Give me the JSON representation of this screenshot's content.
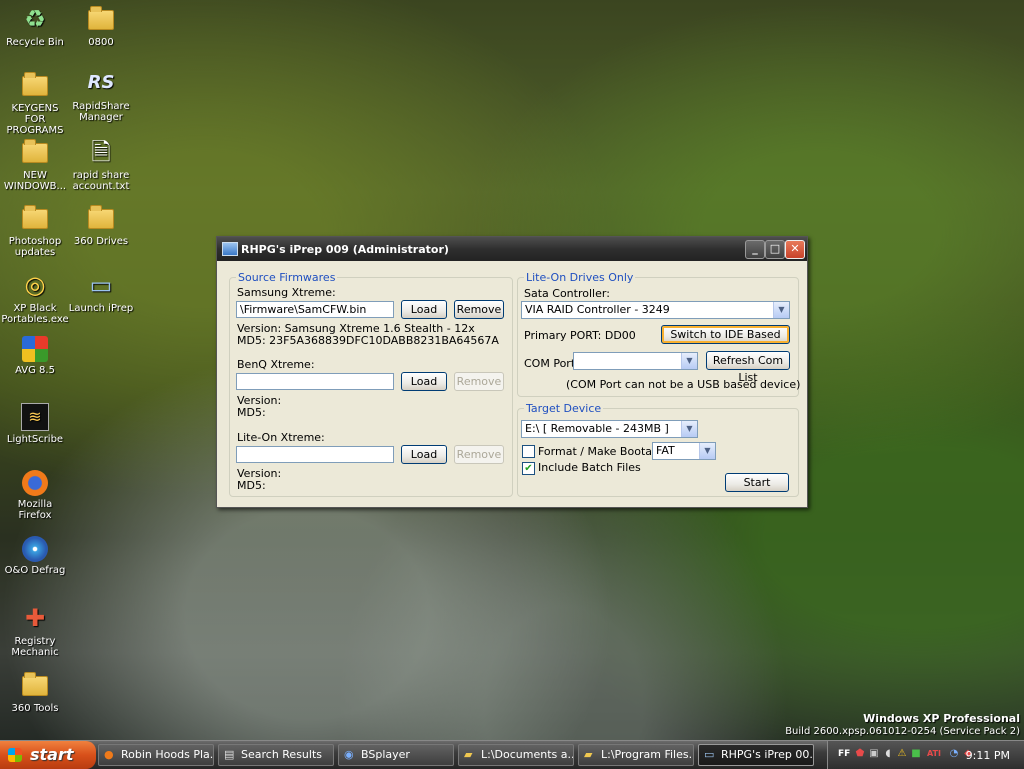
{
  "desktop": {
    "icons": [
      {
        "label": "Recycle Bin",
        "glyph": "recycle-bin-icon"
      },
      {
        "label": "0800",
        "glyph": "folder-icon"
      },
      {
        "label": "KEYGENS FOR PROGRAMS",
        "glyph": "folder-icon"
      },
      {
        "label": "RapidShare Manager",
        "glyph": "rapidshare-icon"
      },
      {
        "label": "NEW WINDOWB...",
        "glyph": "folder-icon"
      },
      {
        "label": "rapid share account.txt",
        "glyph": "text-file-icon"
      },
      {
        "label": "Photoshop updates",
        "glyph": "folder-icon"
      },
      {
        "label": "360 Drives",
        "glyph": "folder-icon"
      },
      {
        "label": "XP Black Portables.exe",
        "glyph": "cd-icon"
      },
      {
        "label": "Launch iPrep",
        "glyph": "monitor-icon"
      },
      {
        "label": "AVG 8.5",
        "glyph": "avg-icon"
      },
      {
        "label": "LightScribe",
        "glyph": "lightscribe-icon"
      },
      {
        "label": "Mozilla Firefox",
        "glyph": "firefox-icon"
      },
      {
        "label": "O&O Defrag",
        "glyph": "defrag-icon"
      },
      {
        "label": "Registry Mechanic",
        "glyph": "registry-mechanic-icon"
      },
      {
        "label": "360 Tools",
        "glyph": "folder-icon"
      }
    ],
    "watermark": {
      "edition": "Windows XP Professional",
      "build": "Build 2600.xpsp.061012-0254 (Service Pack 2)"
    }
  },
  "window": {
    "title": "RHPG's iPrep 009 (Administrator)",
    "controls": {
      "minimize": "_",
      "maximize": "□",
      "close": "✕"
    },
    "source": {
      "group_label": "Source Firmwares",
      "samsung": {
        "label": "Samsung Xtreme:",
        "path": "\\Firmware\\SamCFW.bin",
        "load": "Load",
        "remove": "Remove",
        "version": "Version: Samsung Xtreme 1.6 Stealth - 12x",
        "md5": "MD5: 23F5A368839DFC10DABB8231BA64567A"
      },
      "benq": {
        "label": "BenQ Xtreme:",
        "path": "",
        "load": "Load",
        "remove": "Remove",
        "version": "Version:",
        "md5": "MD5:"
      },
      "liteon": {
        "label": "Lite-On Xtreme:",
        "path": "",
        "load": "Load",
        "remove": "Remove",
        "version": "Version:",
        "md5": "MD5:"
      }
    },
    "liteon_drives": {
      "group_label": "Lite-On Drives Only",
      "sata_label": "Sata Controller:",
      "sata_value": "VIA RAID Controller - 3249",
      "primary_port": "Primary PORT: DD00",
      "switch_button": "Switch to IDE Based",
      "com_label": "COM Port:",
      "com_value": "",
      "refresh_button": "Refresh Com List",
      "com_note": "(COM Port can not be a USB based device)"
    },
    "target": {
      "group_label": "Target Device",
      "device_value": "E:\\ [ Removable - 243MB ]",
      "format_label": "Format / Make Bootable",
      "format_checked": false,
      "fs_value": "FAT",
      "batch_label": "Include Batch Files",
      "batch_checked": true,
      "start_button": "Start"
    }
  },
  "taskbar": {
    "start_label": "start",
    "tasks": [
      {
        "label": "Robin Hoods Pla...",
        "icon": "firefox-icon"
      },
      {
        "label": "Search Results",
        "icon": "search-results-icon"
      },
      {
        "label": "BSplayer",
        "icon": "bsplayer-icon"
      },
      {
        "label": "L:\\Documents a...",
        "icon": "folder-icon"
      },
      {
        "label": "L:\\Program Files...",
        "icon": "folder-icon"
      },
      {
        "label": "RHPG's iPrep 00...",
        "icon": "iprep-icon",
        "active": true
      }
    ],
    "clock": "9:11 PM"
  }
}
